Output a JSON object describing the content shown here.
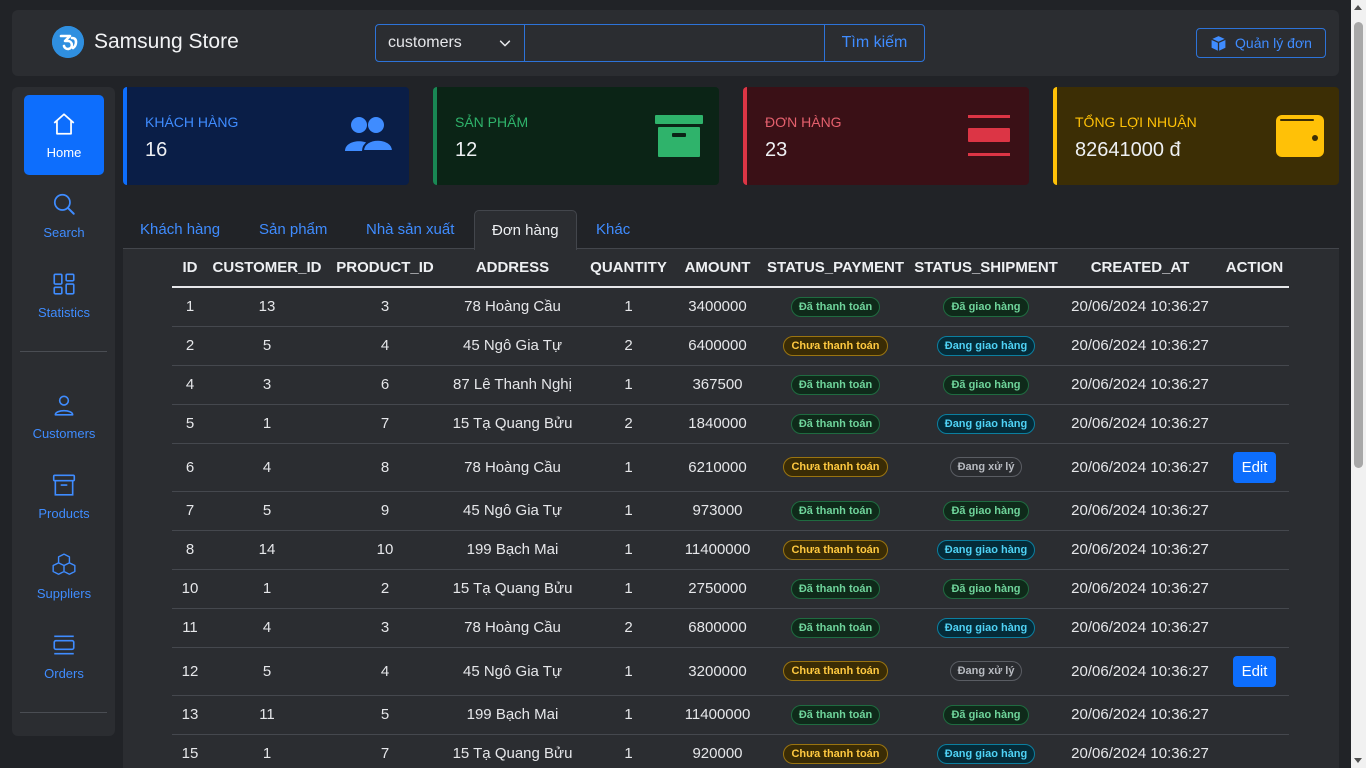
{
  "brand": {
    "name": "Samsung Store",
    "logo_text": "3"
  },
  "search": {
    "category": "customers",
    "value": "",
    "placeholder": "",
    "button_label": "Tìm kiếm"
  },
  "manage_button": {
    "label": "Quản lý đơn"
  },
  "sidebar": {
    "items": [
      {
        "label": "Home",
        "icon": "home-icon",
        "active": true
      },
      {
        "label": "Search",
        "icon": "search-icon"
      },
      {
        "label": "Statistics",
        "icon": "grid-icon"
      },
      {
        "label": "Customers",
        "icon": "user-icon"
      },
      {
        "label": "Products",
        "icon": "archive-icon"
      },
      {
        "label": "Suppliers",
        "icon": "boxes-icon"
      },
      {
        "label": "Orders",
        "icon": "orders-icon"
      }
    ]
  },
  "stats": [
    {
      "label": "KHÁCH HÀNG",
      "value": "16",
      "icon": "people-icon",
      "color": "#0d6efd"
    },
    {
      "label": "SẢN PHẨM",
      "value": "12",
      "icon": "archive-icon",
      "color": "#198754"
    },
    {
      "label": "ĐƠN HÀNG",
      "value": "23",
      "icon": "list-icon",
      "color": "#dc3545"
    },
    {
      "label": "TỔNG LỢI NHUẬN",
      "value": "82641000 đ",
      "icon": "wallet-icon",
      "color": "#ffc107"
    }
  ],
  "tabs": [
    {
      "label": "Khách hàng"
    },
    {
      "label": "Sản phẩm"
    },
    {
      "label": "Nhà sản xuất"
    },
    {
      "label": "Đơn hàng",
      "active": true
    },
    {
      "label": "Khác"
    }
  ],
  "table": {
    "columns": [
      "ID",
      "CUSTOMER_ID",
      "PRODUCT_ID",
      "ADDRESS",
      "QUANTITY",
      "AMOUNT",
      "STATUS_PAYMENT",
      "STATUS_SHIPMENT",
      "CREATED_AT",
      "ACTION"
    ],
    "edit_label": "Edit",
    "rows": [
      {
        "id": "1",
        "customer_id": "13",
        "product_id": "3",
        "address": "78 Hoàng Cầu",
        "quantity": "1",
        "amount": "3400000",
        "payment": "Đã thanh toán",
        "shipment": "Đã giao hàng",
        "created_at": "20/06/2024 10:36:27",
        "editable": false
      },
      {
        "id": "2",
        "customer_id": "5",
        "product_id": "4",
        "address": "45 Ngô Gia Tự",
        "quantity": "2",
        "amount": "6400000",
        "payment": "Chưa thanh toán",
        "shipment": "Đang giao hàng",
        "created_at": "20/06/2024 10:36:27",
        "editable": false
      },
      {
        "id": "4",
        "customer_id": "3",
        "product_id": "6",
        "address": "87 Lê Thanh Nghị",
        "quantity": "1",
        "amount": "367500",
        "payment": "Đã thanh toán",
        "shipment": "Đã giao hàng",
        "created_at": "20/06/2024 10:36:27",
        "editable": false
      },
      {
        "id": "5",
        "customer_id": "1",
        "product_id": "7",
        "address": "15 Tạ Quang Bửu",
        "quantity": "2",
        "amount": "1840000",
        "payment": "Đã thanh toán",
        "shipment": "Đang giao hàng",
        "created_at": "20/06/2024 10:36:27",
        "editable": false
      },
      {
        "id": "6",
        "customer_id": "4",
        "product_id": "8",
        "address": "78 Hoàng Cầu",
        "quantity": "1",
        "amount": "6210000",
        "payment": "Chưa thanh toán",
        "shipment": "Đang xử lý",
        "created_at": "20/06/2024 10:36:27",
        "editable": true
      },
      {
        "id": "7",
        "customer_id": "5",
        "product_id": "9",
        "address": "45 Ngô Gia Tự",
        "quantity": "1",
        "amount": "973000",
        "payment": "Đã thanh toán",
        "shipment": "Đã giao hàng",
        "created_at": "20/06/2024 10:36:27",
        "editable": false
      },
      {
        "id": "8",
        "customer_id": "14",
        "product_id": "10",
        "address": "199 Bạch Mai",
        "quantity": "1",
        "amount": "11400000",
        "payment": "Chưa thanh toán",
        "shipment": "Đang giao hàng",
        "created_at": "20/06/2024 10:36:27",
        "editable": false
      },
      {
        "id": "10",
        "customer_id": "1",
        "product_id": "2",
        "address": "15 Tạ Quang Bửu",
        "quantity": "1",
        "amount": "2750000",
        "payment": "Đã thanh toán",
        "shipment": "Đã giao hàng",
        "created_at": "20/06/2024 10:36:27",
        "editable": false
      },
      {
        "id": "11",
        "customer_id": "4",
        "product_id": "3",
        "address": "78 Hoàng Cầu",
        "quantity": "2",
        "amount": "6800000",
        "payment": "Đã thanh toán",
        "shipment": "Đang giao hàng",
        "created_at": "20/06/2024 10:36:27",
        "editable": false
      },
      {
        "id": "12",
        "customer_id": "5",
        "product_id": "4",
        "address": "45 Ngô Gia Tự",
        "quantity": "1",
        "amount": "3200000",
        "payment": "Chưa thanh toán",
        "shipment": "Đang xử lý",
        "created_at": "20/06/2024 10:36:27",
        "editable": true
      },
      {
        "id": "13",
        "customer_id": "11",
        "product_id": "5",
        "address": "199 Bạch Mai",
        "quantity": "1",
        "amount": "11400000",
        "payment": "Đã thanh toán",
        "shipment": "Đã giao hàng",
        "created_at": "20/06/2024 10:36:27",
        "editable": false
      },
      {
        "id": "15",
        "customer_id": "1",
        "product_id": "7",
        "address": "15 Tạ Quang Bửu",
        "quantity": "1",
        "amount": "920000",
        "payment": "Chưa thanh toán",
        "shipment": "Đang giao hàng",
        "created_at": "20/06/2024 10:36:27",
        "editable": false
      }
    ]
  }
}
